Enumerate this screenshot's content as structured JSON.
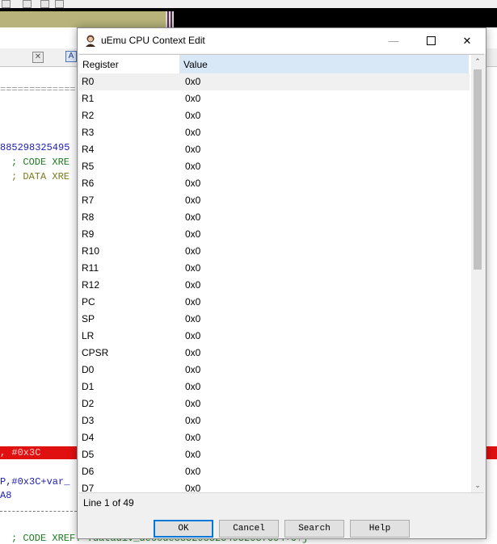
{
  "background": {
    "code_lines": {
      "separator": "=============",
      "addr_ref": "885298325495",
      "code_xref": "; CODE XRE",
      "data_xref": "; DATA XRE",
      "red_line": ", #0x3C",
      "stack_line": "P,#0x3C+var_",
      "a8_line": "A8",
      "bottom_xref": "; CODE XREF: .datadiv_decode8852983254952037604+6↑j"
    }
  },
  "dialog": {
    "title": "uEmu CPU Context Edit",
    "columns": {
      "register": "Register",
      "value": "Value"
    },
    "rows": [
      {
        "reg": "R0",
        "val": "0x0"
      },
      {
        "reg": "R1",
        "val": "0x0"
      },
      {
        "reg": "R2",
        "val": "0x0"
      },
      {
        "reg": "R3",
        "val": "0x0"
      },
      {
        "reg": "R4",
        "val": "0x0"
      },
      {
        "reg": "R5",
        "val": "0x0"
      },
      {
        "reg": "R6",
        "val": "0x0"
      },
      {
        "reg": "R7",
        "val": "0x0"
      },
      {
        "reg": "R8",
        "val": "0x0"
      },
      {
        "reg": "R9",
        "val": "0x0"
      },
      {
        "reg": "R10",
        "val": "0x0"
      },
      {
        "reg": "R11",
        "val": "0x0"
      },
      {
        "reg": "R12",
        "val": "0x0"
      },
      {
        "reg": "PC",
        "val": "0x0"
      },
      {
        "reg": "SP",
        "val": "0x0"
      },
      {
        "reg": "LR",
        "val": "0x0"
      },
      {
        "reg": "CPSR",
        "val": "0x0"
      },
      {
        "reg": "D0",
        "val": "0x0"
      },
      {
        "reg": "D1",
        "val": "0x0"
      },
      {
        "reg": "D2",
        "val": "0x0"
      },
      {
        "reg": "D3",
        "val": "0x0"
      },
      {
        "reg": "D4",
        "val": "0x0"
      },
      {
        "reg": "D5",
        "val": "0x0"
      },
      {
        "reg": "D6",
        "val": "0x0"
      },
      {
        "reg": "D7",
        "val": "0x0"
      }
    ],
    "status": "Line 1 of 49",
    "buttons": {
      "ok": "OK",
      "cancel": "Cancel",
      "search": "Search",
      "help": "Help"
    },
    "window_buttons": {
      "minimize": "—",
      "close": "✕"
    },
    "scroll_arrows": {
      "up": "⌃",
      "down": "⌄"
    },
    "icons": {
      "title": "uemu-app-icon"
    }
  },
  "colors": {
    "header_value_bg": "#d9e8f6",
    "selected_row_bg": "#f0f0f0",
    "highlight_red": "#e01010",
    "default_button_border": "#0078d7"
  }
}
